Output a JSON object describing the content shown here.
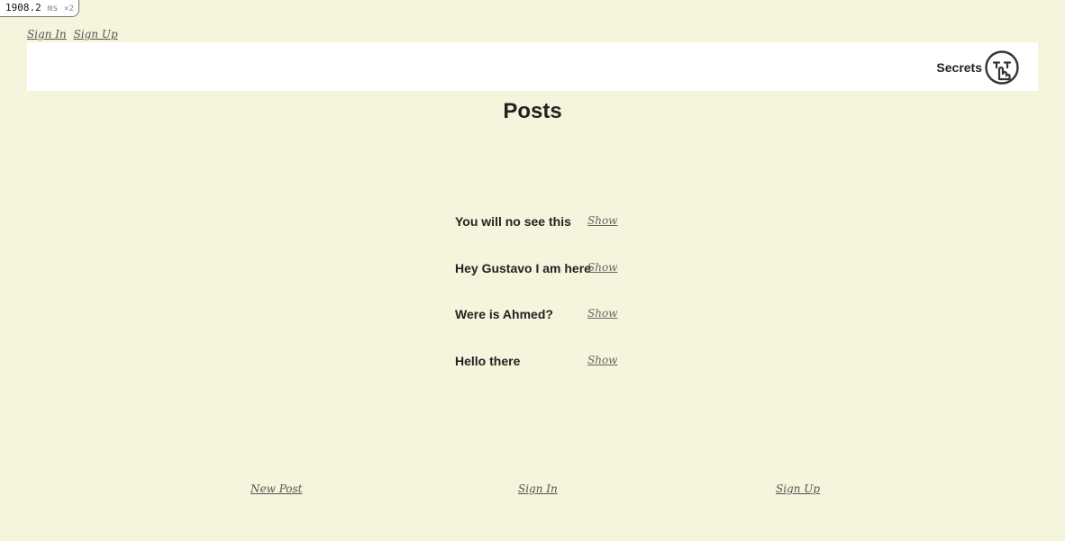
{
  "perf": {
    "value": "1908.2",
    "unit": "ms",
    "multiplier": "×2"
  },
  "top_nav": {
    "sign_in": "Sign In",
    "sign_up": "Sign Up"
  },
  "header": {
    "brand": "Secrets",
    "brand_icon": "shushing-face-icon"
  },
  "page_title": "Posts",
  "posts": [
    {
      "title": "You will no see this",
      "action": "Show"
    },
    {
      "title": "Hey Gustavo I am here",
      "action": "Show"
    },
    {
      "title": "Were is Ahmed?",
      "action": "Show"
    },
    {
      "title": "Hello there",
      "action": "Show"
    }
  ],
  "footer": {
    "new_post": "New Post",
    "sign_in": "Sign In",
    "sign_up": "Sign Up"
  },
  "colors": {
    "background": "#f5f4dc",
    "header_bg": "#ffffff",
    "text": "#222222",
    "link": "#555555"
  }
}
